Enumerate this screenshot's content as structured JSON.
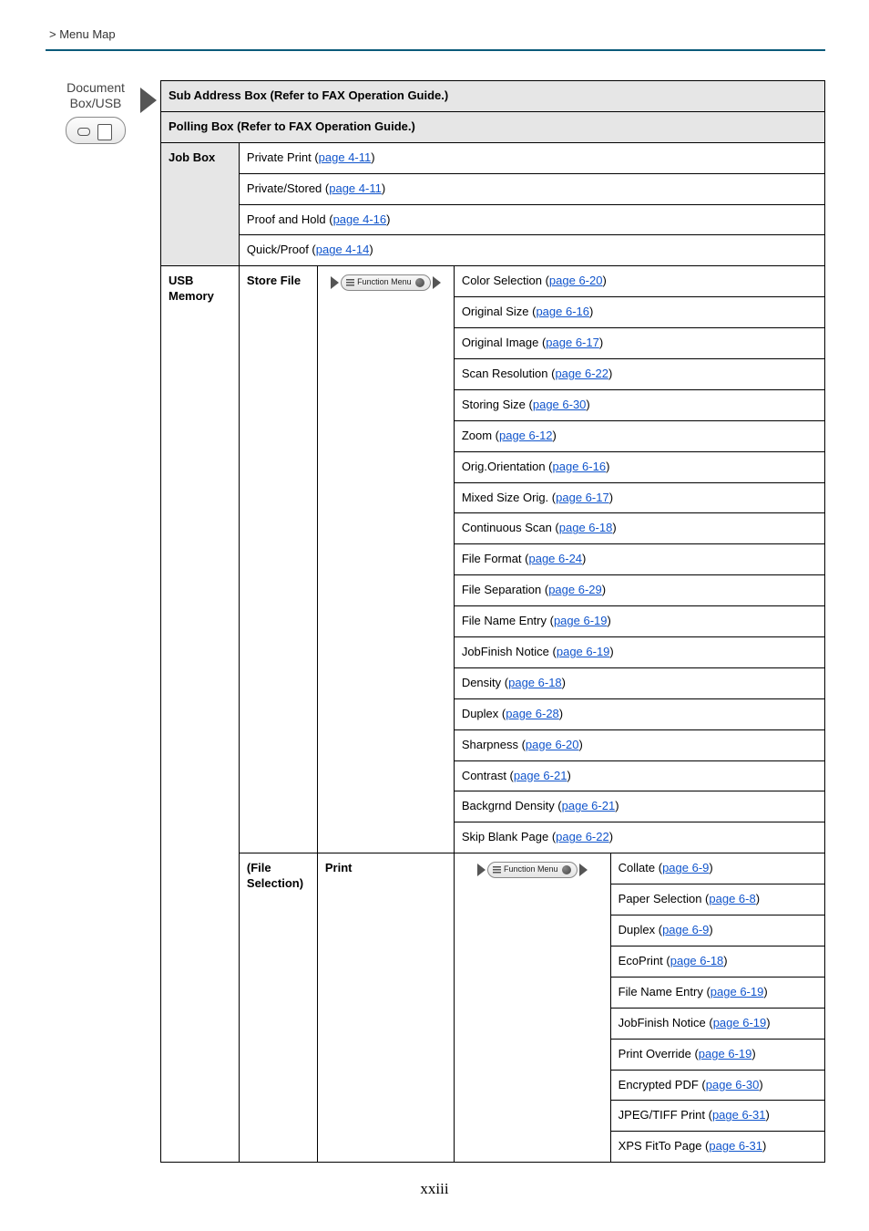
{
  "breadcrumb": "> Menu Map",
  "left": {
    "title_l1": "Document",
    "title_l2": "Box/USB"
  },
  "rows": {
    "sub_address": "Sub Address Box (Refer to FAX Operation Guide.)",
    "polling": "Polling Box (Refer to FAX Operation Guide.)",
    "job_box": "Job Box",
    "jb_private": {
      "t": "Private Print (",
      "l": "page 4-11",
      "e": ")"
    },
    "jb_private_stored": {
      "t": "Private/Stored (",
      "l": "page 4-11",
      "e": ")"
    },
    "jb_proof_hold": {
      "t": "Proof and Hold (",
      "l": "page 4-16",
      "e": ")"
    },
    "jb_quick_proof": {
      "t": "Quick/Proof (",
      "l": "page 4-14",
      "e": ")"
    },
    "usb_memory": "USB Memory",
    "store_file": "Store File",
    "fm_label": "Function Menu",
    "sf": {
      "color_sel": {
        "t": "Color Selection (",
        "l": "page 6-20",
        "e": ")"
      },
      "orig_size": {
        "t": "Original Size (",
        "l": "page 6-16",
        "e": ")"
      },
      "orig_image": {
        "t": "Original Image (",
        "l": "page 6-17",
        "e": ")"
      },
      "scan_res": {
        "t": "Scan Resolution (",
        "l": "page 6-22",
        "e": ")"
      },
      "storing_size": {
        "t": "Storing Size (",
        "l": "page 6-30",
        "e": ")"
      },
      "zoom": {
        "t": "Zoom (",
        "l": "page 6-12",
        "e": ")"
      },
      "orig_orient": {
        "t": "Orig.Orientation (",
        "l": "page 6-16",
        "e": ")"
      },
      "mixed": {
        "t": "Mixed Size Orig. (",
        "l": "page 6-17",
        "e": ")"
      },
      "cont_scan": {
        "t": "Continuous Scan (",
        "l": "page 6-18",
        "e": ")"
      },
      "file_format": {
        "t": "File Format (",
        "l": "page 6-24",
        "e": ")"
      },
      "file_sep": {
        "t": "File Separation (",
        "l": "page 6-29",
        "e": ")"
      },
      "file_name": {
        "t": "File Name Entry (",
        "l": "page 6-19",
        "e": ")"
      },
      "jobfinish": {
        "t": "JobFinish Notice (",
        "l": "page 6-19",
        "e": ")"
      },
      "density": {
        "t": "Density (",
        "l": "page 6-18",
        "e": ")"
      },
      "duplex": {
        "t": "Duplex (",
        "l": "page 6-28",
        "e": ")"
      },
      "sharpness": {
        "t": "Sharpness (",
        "l": "page 6-20",
        "e": ")"
      },
      "contrast": {
        "t": "Contrast (",
        "l": "page 6-21",
        "e": ")"
      },
      "back_density": {
        "t": "Backgrnd Density (",
        "l": "page 6-21",
        "e": ")"
      },
      "skip_blank": {
        "t": "Skip Blank Page (",
        "l": "page 6-22",
        "e": ")"
      }
    },
    "file_selection": "(File Selection)",
    "print": "Print",
    "pr": {
      "collate": {
        "t": "Collate (",
        "l": "page 6-9",
        "e": ")"
      },
      "paper_sel": {
        "t": "Paper Selection (",
        "l": "page 6-8",
        "e": ")"
      },
      "duplex": {
        "t": "Duplex (",
        "l": "page 6-9",
        "e": ")"
      },
      "ecoprint": {
        "t": "EcoPrint (",
        "l": "page 6-18",
        "e": ")"
      },
      "file_name": {
        "t": "File Name Entry (",
        "l": "page 6-19",
        "e": ")"
      },
      "jobfinish": {
        "t": "JobFinish Notice (",
        "l": "page 6-19",
        "e": ")"
      },
      "print_override": {
        "t": "Print Override (",
        "l": "page 6-19",
        "e": ")"
      },
      "encrypted": {
        "t": "Encrypted PDF (",
        "l": "page 6-30",
        "e": ")"
      },
      "jpeg_tiff": {
        "t": "JPEG/TIFF Print (",
        "l": "page 6-31",
        "e": ")"
      },
      "xps_fit": {
        "t": "XPS FitTo Page (",
        "l": "page 6-31",
        "e": ")"
      }
    }
  },
  "footer": "xxiii"
}
